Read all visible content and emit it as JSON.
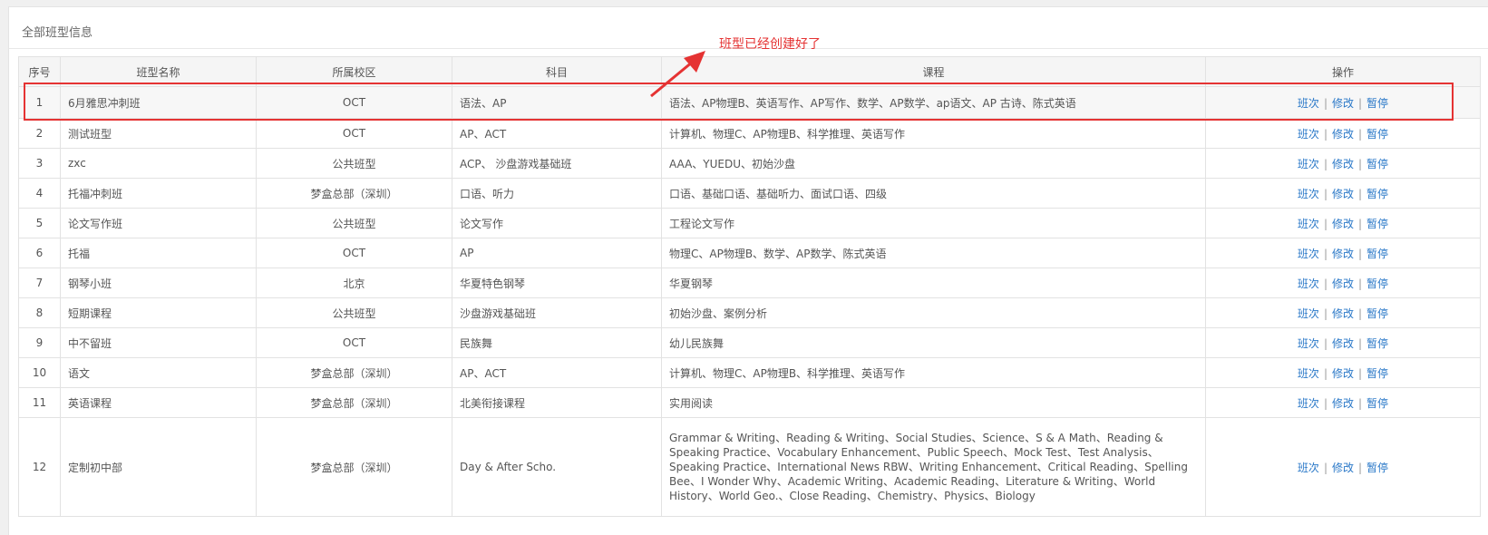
{
  "panel": {
    "title": "全部班型信息"
  },
  "annotation": {
    "text": "班型已经创建好了",
    "color": "#e53333"
  },
  "table": {
    "headers": [
      "序号",
      "班型名称",
      "所属校区",
      "科目",
      "课程",
      "操作"
    ],
    "ops": {
      "sessions": "班次",
      "edit": "修改",
      "pause": "暂停",
      "sep": "|"
    },
    "rows": [
      {
        "no": "1",
        "name": "6月雅思冲刺班",
        "campus": "OCT",
        "subject": "语法、AP",
        "course": "语法、AP物理B、英语写作、AP写作、数学、AP数学、ap语文、AP 古诗、陈式英语"
      },
      {
        "no": "2",
        "name": "测试班型",
        "campus": "OCT",
        "subject": "AP、ACT",
        "course": "计算机、物理C、AP物理B、科学推理、英语写作"
      },
      {
        "no": "3",
        "name": "zxc",
        "campus": "公共班型",
        "subject": "ACP、 沙盘游戏基础班",
        "course": "AAA、YUEDU、初始沙盘"
      },
      {
        "no": "4",
        "name": "托福冲刺班",
        "campus": "梦盒总部（深圳）",
        "subject": "口语、听力",
        "course": "口语、基础口语、基础听力、面试口语、四级"
      },
      {
        "no": "5",
        "name": "论文写作班",
        "campus": "公共班型",
        "subject": "论文写作",
        "course": "工程论文写作"
      },
      {
        "no": "6",
        "name": "托福",
        "campus": "OCT",
        "subject": "AP",
        "course": "物理C、AP物理B、数学、AP数学、陈式英语"
      },
      {
        "no": "7",
        "name": "钢琴小班",
        "campus": "北京",
        "subject": "华夏特色钢琴",
        "course": "华夏钢琴"
      },
      {
        "no": "8",
        "name": "短期课程",
        "campus": "公共班型",
        "subject": "沙盘游戏基础班",
        "course": "初始沙盘、案例分析"
      },
      {
        "no": "9",
        "name": "中不留班",
        "campus": "OCT",
        "subject": "民族舞",
        "course": "幼儿民族舞"
      },
      {
        "no": "10",
        "name": "语文",
        "campus": "梦盒总部（深圳）",
        "subject": "AP、ACT",
        "course": "计算机、物理C、AP物理B、科学推理、英语写作"
      },
      {
        "no": "11",
        "name": "英语课程",
        "campus": "梦盒总部（深圳）",
        "subject": "北美衔接课程",
        "course": "实用阅读"
      },
      {
        "no": "12",
        "name": "定制初中部",
        "campus": "梦盒总部（深圳）",
        "subject": "Day & After Scho.",
        "course": "Grammar & Writing、Reading & Writing、Social Studies、Science、S & A Math、Reading & Speaking Practice、Vocabulary Enhancement、Public Speech、Mock Test、Test Analysis、Speaking Practice、International News RBW、Writing Enhancement、Critical Reading、Spelling Bee、I Wonder Why、Academic Writing、Academic Reading、Literature & Writing、World History、World Geo.、Close Reading、Chemistry、Physics、Biology"
      }
    ]
  }
}
